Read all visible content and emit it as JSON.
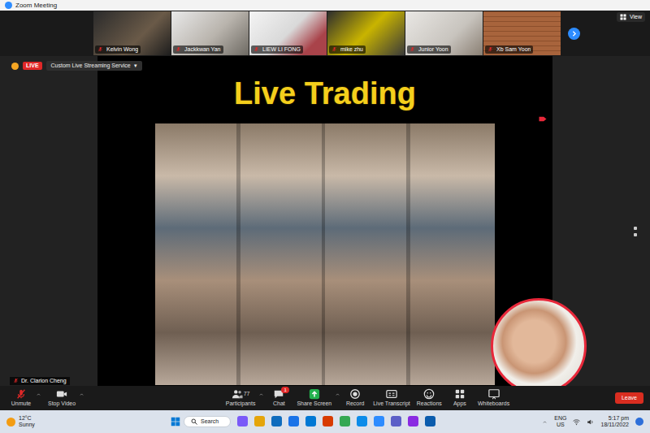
{
  "window": {
    "title": "Zoom Meeting"
  },
  "gallery": {
    "participants": [
      {
        "name": "Kelvin Wong",
        "muted": true
      },
      {
        "name": "Jackkwan Yan",
        "muted": true
      },
      {
        "name": "LIEW LI FONG",
        "muted": true
      },
      {
        "name": "mike zhu",
        "muted": true
      },
      {
        "name": "Junior Yoon",
        "muted": true
      },
      {
        "name": "Xb Sam Yoon",
        "muted": true
      }
    ],
    "view_label": "View"
  },
  "stream": {
    "live_badge": "LIVE",
    "service": "Custom Live Streaming Service",
    "dropdown_arrow": "▾"
  },
  "slide": {
    "title": "Live Trading"
  },
  "speaker": {
    "name": "Dr. Clarion Cheng",
    "muted": true
  },
  "toolbar": {
    "left": [
      {
        "label": "Unmute",
        "kind": "mic",
        "muted": true,
        "has_menu": true
      },
      {
        "label": "Stop Video",
        "kind": "camera",
        "has_menu": true
      }
    ],
    "center": [
      {
        "label": "Participants",
        "kind": "people",
        "count": "77",
        "has_menu": true
      },
      {
        "label": "Chat",
        "kind": "chat",
        "badge": "1",
        "has_menu": false
      },
      {
        "label": "Share Screen",
        "kind": "share",
        "has_menu": true
      },
      {
        "label": "Record",
        "kind": "record",
        "has_menu": false
      },
      {
        "label": "Live Transcript",
        "kind": "transcript",
        "has_menu": false
      },
      {
        "label": "Reactions",
        "kind": "reactions",
        "has_menu": false
      },
      {
        "label": "Apps",
        "kind": "apps",
        "has_menu": false
      },
      {
        "label": "Whiteboards",
        "kind": "whiteboard",
        "has_menu": false
      }
    ],
    "leave": "Leave"
  },
  "taskbar": {
    "weather": {
      "temp": "12°C",
      "condition": "Sunny"
    },
    "search": "Search",
    "apps": [
      {
        "color": "#7a5af8"
      },
      {
        "color": "#e5a50a"
      },
      {
        "color": "#0f6cbd"
      },
      {
        "color": "#1a73e8"
      },
      {
        "color": "#0078d4"
      },
      {
        "color": "#d83b01"
      },
      {
        "color": "#34a853"
      },
      {
        "color": "#0c8ce9"
      },
      {
        "color": "#2d8cff"
      },
      {
        "color": "#5b5fc7"
      },
      {
        "color": "#8a2be2"
      },
      {
        "color": "#0b5cad"
      }
    ],
    "lang": "ENG",
    "region": "US",
    "time": "5:17 pm",
    "date": "18/11/2022"
  }
}
